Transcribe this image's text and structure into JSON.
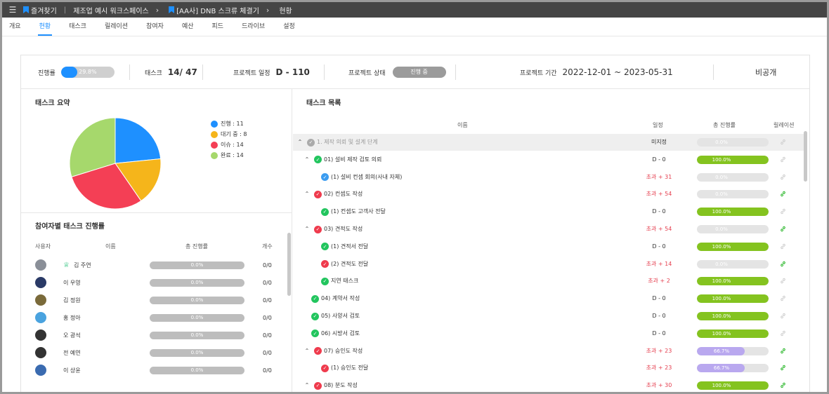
{
  "topbar": {
    "favorites": "즐겨찾기",
    "workspace": "제조업 예시 워크스페이스",
    "project": "[AA사] DNB 스크류 체결기",
    "page": "현황"
  },
  "tabs": [
    "개요",
    "현황",
    "태스크",
    "릴레이션",
    "참여자",
    "예산",
    "피드",
    "드라이브",
    "설정"
  ],
  "active_tab": "현황",
  "summary": {
    "progress_label": "진행률",
    "progress_value": "29.8%",
    "progress_fraction": 0.298,
    "task_label": "태스크",
    "task_value": "14/ 47",
    "schedule_label": "프로젝트 일정",
    "schedule_value": "D - 110",
    "status_label": "프로젝트 상태",
    "status_value": "진행 중",
    "period_label": "프로젝트 기간",
    "period_value": "2022-12-01 ~ 2023-05-31",
    "visibility": "비공개"
  },
  "task_summary": {
    "title": "태스크 요약",
    "legend": [
      {
        "label": "진행 : 11",
        "color": "#1e90ff",
        "value": 11
      },
      {
        "label": "대기 중 : 8",
        "color": "#f5b51b",
        "value": 8
      },
      {
        "label": "이슈 : 14",
        "color": "#f43f55",
        "value": 14
      },
      {
        "label": "완료 : 14",
        "color": "#a6d86c",
        "value": 14
      }
    ]
  },
  "participants": {
    "title": "참여자별 태스크 진행률",
    "headers": {
      "user": "사용자",
      "name": "이름",
      "progress": "총 진행률",
      "count": "개수"
    },
    "rows": [
      {
        "name": "김 주연",
        "progress": "0.0%",
        "count": "0/0",
        "avatar_color": "#8a8f98",
        "crown": true
      },
      {
        "name": "이 우영",
        "progress": "0.0%",
        "count": "0/0",
        "avatar_color": "#2a3a66",
        "crown": false
      },
      {
        "name": "김 정원",
        "progress": "0.0%",
        "count": "0/0",
        "avatar_color": "#7a6a3a",
        "crown": false
      },
      {
        "name": "홍 정아",
        "progress": "0.0%",
        "count": "0/0",
        "avatar_color": "#4aa3df",
        "crown": false
      },
      {
        "name": "오 광석",
        "progress": "0.0%",
        "count": "0/0",
        "avatar_color": "#333333",
        "crown": false
      },
      {
        "name": "전 예연",
        "progress": "0.0%",
        "count": "0/0",
        "avatar_color": "#333333",
        "crown": false
      },
      {
        "name": "이 상윤",
        "progress": "0.0%",
        "count": "0/0",
        "avatar_color": "#3a6bb0",
        "crown": false
      }
    ]
  },
  "task_list": {
    "title": "태스크 목록",
    "headers": {
      "name": "이름",
      "schedule": "일정",
      "progress": "총 진행률",
      "relation": "릴레이션"
    },
    "rows": [
      {
        "name": "1. 제작 의뢰 및 설계 단계",
        "level": 0,
        "chevron": true,
        "check": "grey",
        "schedule": "미지정",
        "sched_type": "normal",
        "progress": "0.0%",
        "fraction": 0,
        "bar": "none",
        "rel": "grey",
        "grey": true,
        "muted": true
      },
      {
        "name": "01) 설비 제작 검토 의뢰",
        "level": 1,
        "chevron": true,
        "check": "green",
        "schedule": "D - 0",
        "sched_type": "normal",
        "progress": "100.0%",
        "fraction": 1,
        "bar": "green",
        "rel": "grey"
      },
      {
        "name": "(1) 설비 컨셉 회의(사내 자체)",
        "level": 2,
        "chevron": false,
        "check": "blue",
        "schedule": "초과 + 31",
        "sched_type": "over",
        "progress": "0.0%",
        "fraction": 0,
        "bar": "none",
        "rel": "grey"
      },
      {
        "name": "02) 컨셉도 작성",
        "level": 1,
        "chevron": true,
        "check": "red",
        "schedule": "초과 + 54",
        "sched_type": "over",
        "progress": "0.0%",
        "fraction": 0,
        "bar": "none",
        "rel": "green"
      },
      {
        "name": "(1) 컨셉도 고객사 전달",
        "level": 2,
        "chevron": false,
        "check": "green",
        "schedule": "D - 0",
        "sched_type": "normal",
        "progress": "100.0%",
        "fraction": 1,
        "bar": "green",
        "rel": "grey"
      },
      {
        "name": "03) 견적도 작성",
        "level": 1,
        "chevron": true,
        "check": "red",
        "schedule": "초과 + 54",
        "sched_type": "over",
        "progress": "0.0%",
        "fraction": 0,
        "bar": "none",
        "rel": "green"
      },
      {
        "name": "(1) 견적서 전달",
        "level": 2,
        "chevron": false,
        "check": "green",
        "schedule": "D - 0",
        "sched_type": "normal",
        "progress": "100.0%",
        "fraction": 1,
        "bar": "green",
        "rel": "grey"
      },
      {
        "name": "(2) 견적도 전달",
        "level": 2,
        "chevron": false,
        "check": "red",
        "schedule": "초과 + 14",
        "sched_type": "over",
        "progress": "0.0%",
        "fraction": 0,
        "bar": "none",
        "rel": "green"
      },
      {
        "name": "지연 태스크",
        "level": 2,
        "chevron": false,
        "check": "green",
        "schedule": "초과 + 2",
        "sched_type": "over",
        "progress": "100.0%",
        "fraction": 1,
        "bar": "green",
        "rel": "grey"
      },
      {
        "name": "04) 계약서 작성",
        "level": 1.5,
        "chevron": false,
        "check": "green",
        "schedule": "D - 0",
        "sched_type": "normal",
        "progress": "100.0%",
        "fraction": 1,
        "bar": "green",
        "rel": "grey"
      },
      {
        "name": "05) 사양서 검토",
        "level": 1.5,
        "chevron": false,
        "check": "green",
        "schedule": "D - 0",
        "sched_type": "normal",
        "progress": "100.0%",
        "fraction": 1,
        "bar": "green",
        "rel": "grey"
      },
      {
        "name": "06) 시방서 검토",
        "level": 1.5,
        "chevron": false,
        "check": "green",
        "schedule": "D - 0",
        "sched_type": "normal",
        "progress": "100.0%",
        "fraction": 1,
        "bar": "green",
        "rel": "grey"
      },
      {
        "name": "07) 승인도 작성",
        "level": 1,
        "chevron": true,
        "check": "red",
        "schedule": "초과 + 23",
        "sched_type": "over",
        "progress": "66.7%",
        "fraction": 0.667,
        "bar": "purple",
        "rel": "green"
      },
      {
        "name": "(1) 승인도 전달",
        "level": 2,
        "chevron": false,
        "check": "red",
        "schedule": "초과 + 23",
        "sched_type": "over",
        "progress": "66.7%",
        "fraction": 0.667,
        "bar": "purple",
        "rel": "green"
      },
      {
        "name": "08) 분도 작성",
        "level": 1,
        "chevron": true,
        "check": "red",
        "schedule": "초과 + 30",
        "sched_type": "over",
        "progress": "100.0%",
        "fraction": 1,
        "bar": "green",
        "rel": "green"
      }
    ]
  },
  "colors": {
    "accent": "#1e90ff",
    "bar_green": "#84c31f",
    "bar_purple": "#b9a8ef",
    "over": "#e53e4e",
    "rel_green": "#2eb82e"
  }
}
